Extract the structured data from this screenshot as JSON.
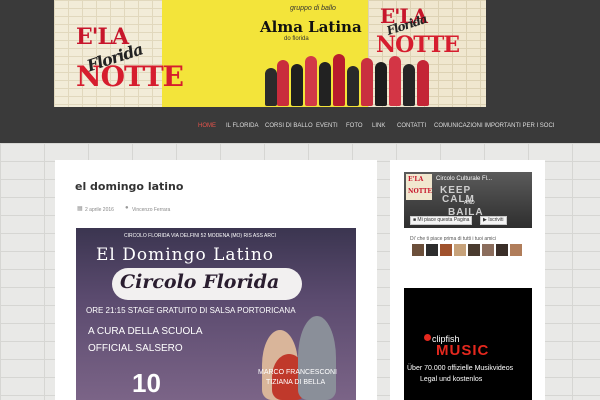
{
  "banner": {
    "logo_left": {
      "ela": "E'LA",
      "florida": "Florida",
      "notte": "NOTTE"
    },
    "logo_right": {
      "ela": "E'LA",
      "florida": "Florida",
      "notte": "NOTTE"
    },
    "gruppo": "gruppo di ballo",
    "alma_latina": "Alma Latina",
    "do_florida": "do florida"
  },
  "nav": {
    "items": [
      {
        "label": "HOME",
        "active": true
      },
      {
        "label": "IL FLORIDA"
      },
      {
        "label": "CORSI DI BALLO"
      },
      {
        "label": "EVENTI"
      },
      {
        "label": "FOTO"
      },
      {
        "label": "LINK"
      },
      {
        "label": "CONTATTI"
      },
      {
        "label": "COMUNICAZIONI IMPORTANTI PER I SOCI"
      }
    ]
  },
  "post": {
    "title": "el domingo latino",
    "date": "2 aprile 2016",
    "author": "Vincenzo Ferrara",
    "calendar_icon": "calendar-icon",
    "user_icon": "user-icon"
  },
  "poster": {
    "address": "CIRCOLO FLORIDA VIA DELFINI 52 MODENA (MO) RIS ASS ARCI",
    "heading": "El Domingo Latino",
    "circolo": "Circolo Florida",
    "ore": "ORE 21:15 STAGE GRATUITO DI SALSA PORTORICANA",
    "cura": "A CURA DELLA SCUOLA",
    "official": "OFFICIAL SALSERO",
    "day": "10",
    "marco": "MARCO FRANCESCONI",
    "tiziana": "TIZIANA DI BELLA"
  },
  "facebook": {
    "page_name": "Circolo Culturale Fl...",
    "thumb_ela": "E'LA",
    "thumb_notte": "NOTTE",
    "keep": "KEEP",
    "calm": "CALM",
    "and": "AND",
    "baila": "BAILA",
    "like_button": "Mi piace questa Pagina",
    "subscribe_button": "Iscriviti",
    "friends_text": "Di' che ti piace prima di tutti i tuoi amici"
  },
  "ad": {
    "logo": "clipfish",
    "music": "MUSIC",
    "line1": "Über 70.000 offizielle Musikvideos",
    "line2": "Legal und kostenlos"
  },
  "colors": {
    "header_bg": "#3a3a3a",
    "banner_yellow": "#f3e43a",
    "nav_active": "#e5534b",
    "ad_red": "#e4281e"
  }
}
